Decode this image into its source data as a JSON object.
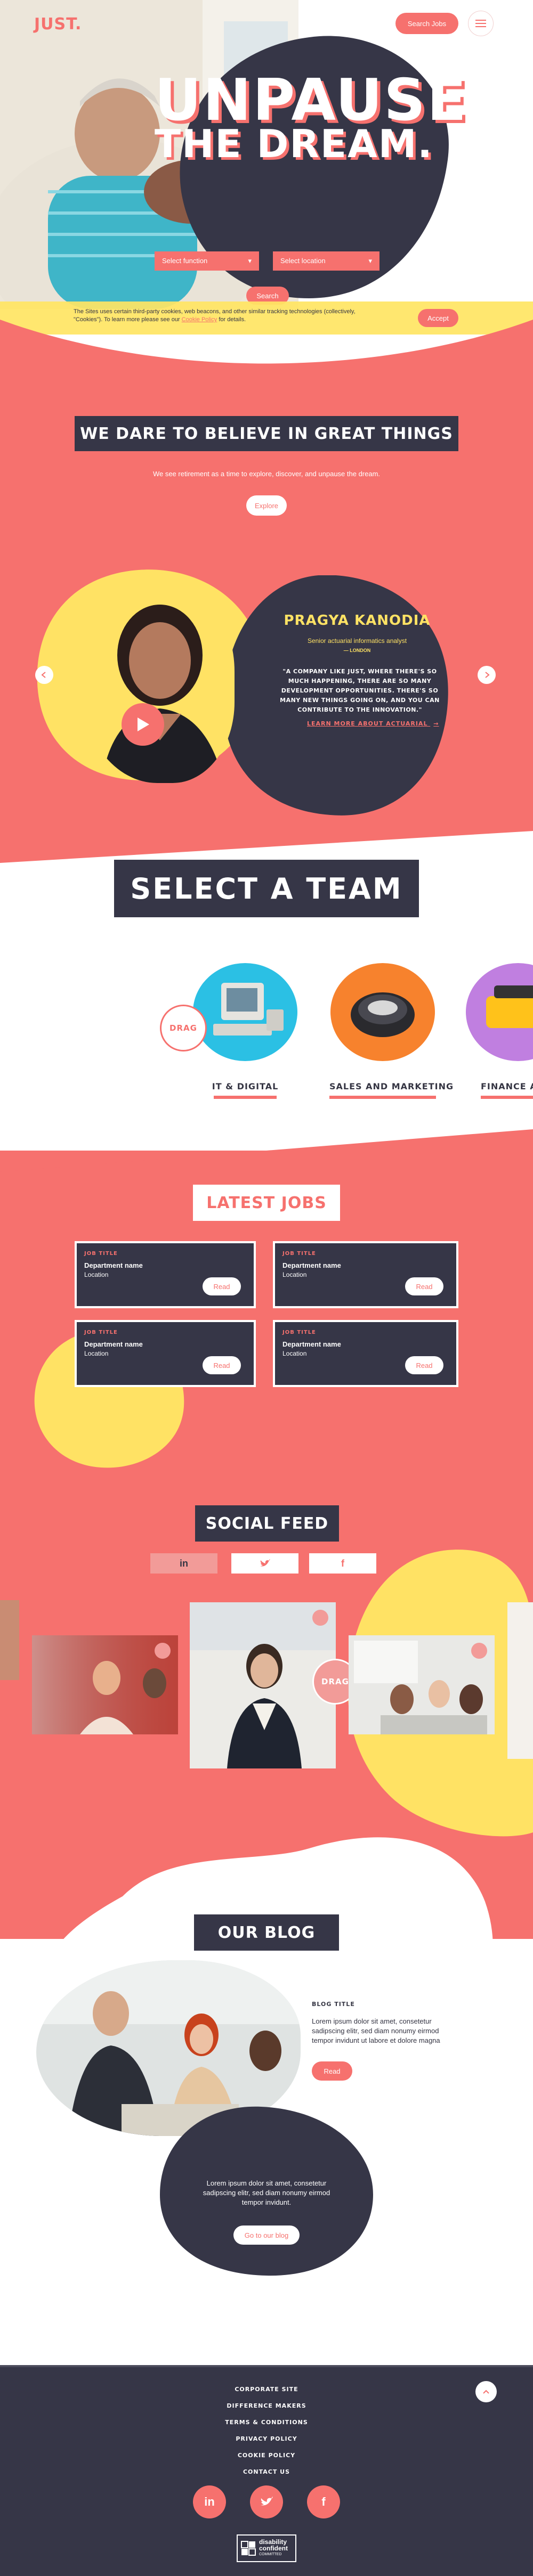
{
  "header": {
    "logo": "JUST.",
    "search_label": "Search Jobs",
    "menu_icon": "hamburger-icon"
  },
  "hero": {
    "title_line1": "UNPAUSE",
    "title_line2": "THE DREAM.",
    "function_select": "Select function",
    "location_select": "Select location",
    "search_label": "Search"
  },
  "cookie": {
    "text": "The Sites uses certain third-party cookies, web beacons, and other similar tracking technologies (collectively, \"Cookies\"). To learn more please see our",
    "link": "Cookie Policy",
    "text_end": "for details.",
    "accept": "Accept"
  },
  "believe": {
    "title": "WE DARE TO BELIEVE IN GREAT THINGS",
    "subtitle": "We see retirement as a time to explore, discover, and unpause the dream.",
    "explore": "Explore"
  },
  "testimonial": {
    "name": "PRAGYA KANODIA",
    "role": "Senior actuarial informatics analyst",
    "location": "— LONDON",
    "quote": "\"A COMPANY LIKE JUST, WHERE THERE'S SO MUCH HAPPENING, THERE ARE SO MANY DEVELOPMENT OPPORTUNITIES. THERE'S SO MANY NEW THINGS GOING ON, AND YOU CAN CONTRIBUTE TO THE INNOVATION.\"",
    "link": "LEARN MORE ABOUT ACTUARIAL"
  },
  "teams": {
    "title": "SELECT A TEAM",
    "drag": "DRAG",
    "items": [
      {
        "label": "IT & DIGITAL"
      },
      {
        "label": "SALES AND MARKETING"
      },
      {
        "label": "FINANCE AN"
      }
    ]
  },
  "jobs": {
    "title": "LATEST JOBS",
    "items": [
      {
        "tag": "JOB TITLE",
        "dept": "Department name",
        "loc": "Location",
        "btn": "Read"
      },
      {
        "tag": "JOB TITLE",
        "dept": "Department name",
        "loc": "Location",
        "btn": "Read"
      },
      {
        "tag": "JOB TITLE",
        "dept": "Department name",
        "loc": "Location",
        "btn": "Read"
      },
      {
        "tag": "JOB TITLE",
        "dept": "Department name",
        "loc": "Location",
        "btn": "Read"
      }
    ]
  },
  "social": {
    "title": "SOCIAL FEED",
    "tabs": [
      {
        "label": "in"
      },
      {
        "label": "twitter"
      },
      {
        "label": "f"
      }
    ],
    "drag": "DRAG"
  },
  "blog": {
    "title": "OUR BLOG",
    "post_tag": "BLOG TITLE",
    "post_text": "Lorem ipsum dolor sit amet, consetetur sadipscing elitr, sed diam nonumy eirmod tempor invidunt ut labore et dolore magna",
    "read": "Read",
    "intro": "Lorem ipsum dolor sit amet, consetetur sadipscing elitr, sed diam nonumy eirmod tempor invidunt.",
    "goto": "Go to our blog"
  },
  "footer": {
    "links": [
      "CORPORATE SITE",
      "DIFFERENCE MAKERS",
      "TERMS & CONDITIONS",
      "PRIVACY POLICY",
      "COOKIE POLICY",
      "CONTACT US"
    ],
    "badge_line1": "disability",
    "badge_line2": "confident",
    "badge_line3": "COMMITTED"
  }
}
